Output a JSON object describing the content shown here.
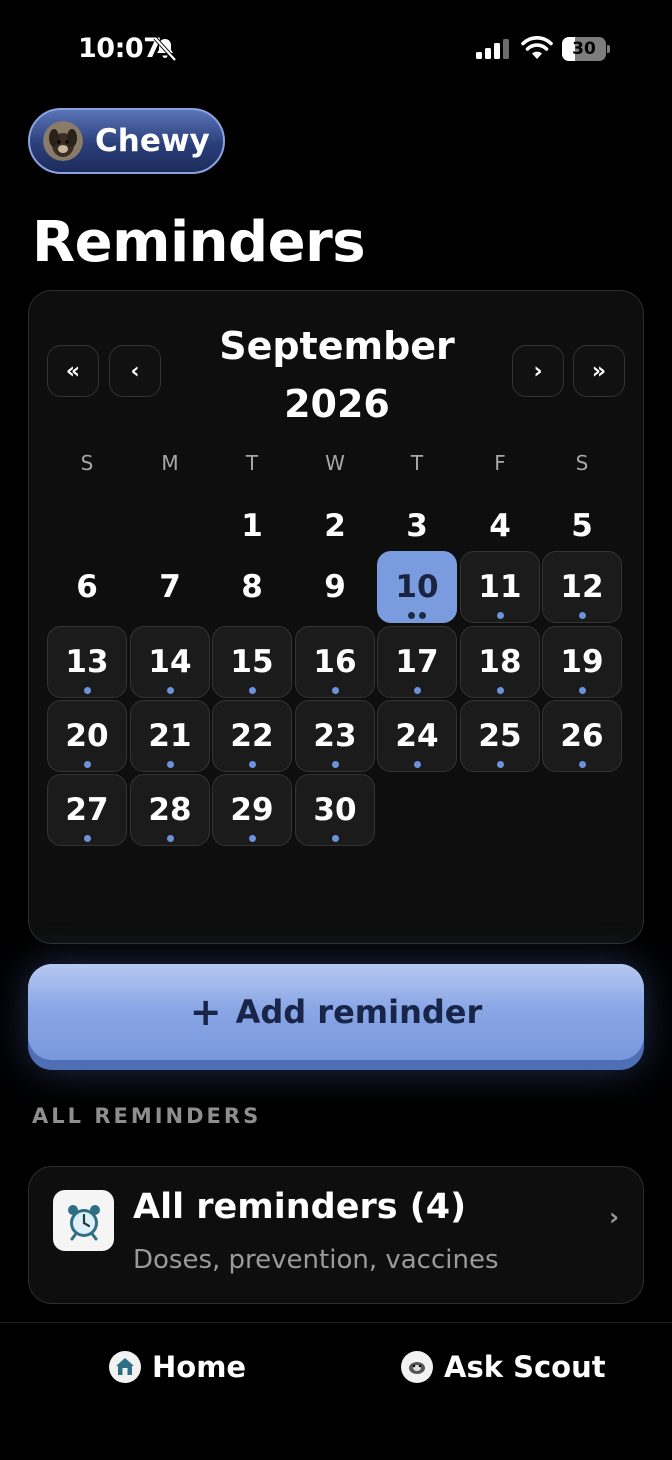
{
  "status_bar": {
    "time": "10:07",
    "battery": "30",
    "battery_level": 0.3
  },
  "pet": {
    "name": "Chewy"
  },
  "page": {
    "title": "Reminders"
  },
  "calendar": {
    "month": "September",
    "year": "2026",
    "nav": {
      "prev_year": "«",
      "prev_month": "‹",
      "next_month": "›",
      "next_year": "»"
    },
    "weekdays": [
      "S",
      "M",
      "T",
      "W",
      "T",
      "F",
      "S"
    ],
    "first_weekday_index": 2,
    "days_in_month": 30,
    "selected_day": 10,
    "day_dots": {
      "10": 2,
      "11": 1,
      "12": 1,
      "13": 1,
      "14": 1,
      "15": 1,
      "16": 1,
      "17": 1,
      "18": 1,
      "19": 1,
      "20": 1,
      "21": 1,
      "22": 1,
      "23": 1,
      "24": 1,
      "25": 1,
      "26": 1,
      "27": 1,
      "28": 1,
      "29": 1,
      "30": 1
    }
  },
  "actions": {
    "add_reminder_label": "Add reminder",
    "add_icon": "+"
  },
  "section": {
    "label": "ALL REMINDERS"
  },
  "list": [
    {
      "icon": "alarm-clock-icon",
      "title": "All reminders (4)",
      "subtitle": "Doses, prevention, vaccines",
      "chevron": "›"
    }
  ],
  "tabs": [
    {
      "icon": "home-icon",
      "label": "Home"
    },
    {
      "icon": "scout-icon",
      "label": "Ask Scout"
    }
  ],
  "colors": {
    "accent": "#7a9cdf",
    "accent_dark": "#1d2c5c",
    "background": "#000000"
  }
}
